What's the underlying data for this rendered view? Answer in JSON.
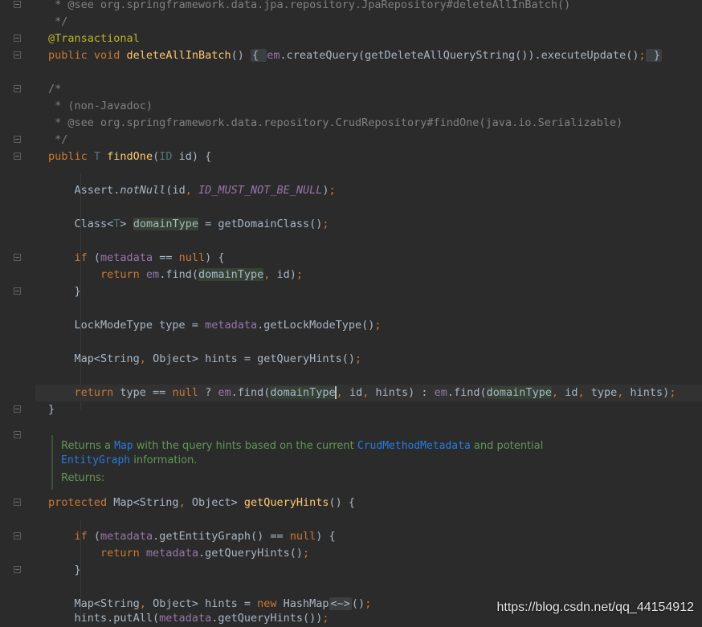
{
  "lines": [
    {
      "t": 6,
      "parts": [
        {
          "c": "cm",
          "s": " * @see org.springframework.data.jpa.repository.JpaRepository#deleteAllInBatch()"
        }
      ]
    },
    {
      "t": 27,
      "parts": [
        {
          "c": "cm",
          "s": " */"
        }
      ]
    },
    {
      "t": 48,
      "parts": [
        {
          "c": "an",
          "s": "@Transactional"
        }
      ]
    },
    {
      "t": 69,
      "parts": [
        {
          "c": "kw",
          "s": "public void "
        },
        {
          "c": "fn",
          "s": "deleteAllInBatch"
        },
        {
          "c": "",
          "s": "() "
        },
        {
          "c": "fold-inl",
          "s": "{ "
        },
        {
          "c": "fld",
          "s": "em"
        },
        {
          "c": "",
          "s": ".createQuery(getDeleteAllQueryString()).executeUpdate()"
        },
        {
          "c": "kw",
          "s": ";"
        },
        {
          "c": "fold-inl",
          "s": " }"
        }
      ]
    },
    {
      "t": 111,
      "parts": [
        {
          "c": "cm",
          "s": "/*"
        }
      ]
    },
    {
      "t": 132,
      "parts": [
        {
          "c": "cm",
          "s": " * (non-Javadoc)"
        }
      ]
    },
    {
      "t": 153,
      "parts": [
        {
          "c": "cm",
          "s": " * @see org.springframework.data.repository.CrudRepository#findOne(java.io.Serializable)"
        }
      ]
    },
    {
      "t": 174,
      "parts": [
        {
          "c": "cm",
          "s": " */"
        }
      ]
    },
    {
      "t": 195,
      "parts": [
        {
          "c": "kw",
          "s": "public "
        },
        {
          "c": "tp",
          "s": "T "
        },
        {
          "c": "fn",
          "s": "findOne"
        },
        {
          "c": "",
          "s": "("
        },
        {
          "c": "tp",
          "s": "ID"
        },
        {
          "c": "",
          "s": " id) {"
        }
      ]
    },
    {
      "t": 237,
      "parts": [
        {
          "c": "",
          "s": "    Assert."
        },
        {
          "c": "it",
          "s": "notNull"
        },
        {
          "c": "",
          "s": "(id"
        },
        {
          "c": "kw",
          "s": ", "
        },
        {
          "c": "cst",
          "s": "ID_MUST_NOT_BE_NULL"
        },
        {
          "c": "",
          "s": ")"
        },
        {
          "c": "kw",
          "s": ";"
        }
      ]
    },
    {
      "t": 279,
      "parts": [
        {
          "c": "",
          "s": "    Class<"
        },
        {
          "c": "tp",
          "s": "T"
        },
        {
          "c": "",
          "s": "> "
        },
        {
          "c": "hl",
          "s": "domainType"
        },
        {
          "c": "",
          "s": " = getDomainClass()"
        },
        {
          "c": "kw",
          "s": ";"
        }
      ]
    },
    {
      "t": 321,
      "parts": [
        {
          "c": "kw",
          "s": "    if "
        },
        {
          "c": "",
          "s": "("
        },
        {
          "c": "fld",
          "s": "metadata"
        },
        {
          "c": "",
          "s": " == "
        },
        {
          "c": "kw",
          "s": "null"
        },
        {
          "c": "",
          "s": ") {"
        }
      ]
    },
    {
      "t": 342,
      "parts": [
        {
          "c": "kw",
          "s": "        return "
        },
        {
          "c": "fld",
          "s": "em"
        },
        {
          "c": "",
          "s": ".find("
        },
        {
          "c": "hl",
          "s": "domainType"
        },
        {
          "c": "kw",
          "s": ", "
        },
        {
          "c": "",
          "s": "id)"
        },
        {
          "c": "kw",
          "s": ";"
        }
      ]
    },
    {
      "t": 363,
      "parts": [
        {
          "c": "",
          "s": "    }"
        }
      ]
    },
    {
      "t": 405,
      "parts": [
        {
          "c": "",
          "s": "    LockModeType type = "
        },
        {
          "c": "fld",
          "s": "metadata"
        },
        {
          "c": "",
          "s": ".getLockModeType()"
        },
        {
          "c": "kw",
          "s": ";"
        }
      ]
    },
    {
      "t": 447,
      "parts": [
        {
          "c": "",
          "s": "    Map<String"
        },
        {
          "c": "kw",
          "s": ", "
        },
        {
          "c": "",
          "s": "Object> hints = getQueryHints()"
        },
        {
          "c": "kw",
          "s": ";"
        }
      ]
    },
    {
      "t": 489,
      "cur": true,
      "parts": [
        {
          "c": "kw",
          "s": "    return "
        },
        {
          "c": "",
          "s": "type == "
        },
        {
          "c": "kw",
          "s": "null "
        },
        {
          "c": "",
          "s": "? "
        },
        {
          "c": "fld",
          "s": "em"
        },
        {
          "c": "",
          "s": ".find("
        },
        {
          "c": "hl",
          "s": "domainType"
        },
        {
          "c": "caret",
          "s": ""
        },
        {
          "c": "kw",
          "s": ", "
        },
        {
          "c": "",
          "s": "id"
        },
        {
          "c": "kw",
          "s": ", "
        },
        {
          "c": "",
          "s": "hints) : "
        },
        {
          "c": "fld",
          "s": "em"
        },
        {
          "c": "",
          "s": ".find("
        },
        {
          "c": "hl",
          "s": "domainType"
        },
        {
          "c": "kw",
          "s": ", "
        },
        {
          "c": "",
          "s": "id"
        },
        {
          "c": "kw",
          "s": ", "
        },
        {
          "c": "",
          "s": "type"
        },
        {
          "c": "kw",
          "s": ", "
        },
        {
          "c": "",
          "s": "hints)"
        },
        {
          "c": "kw",
          "s": ";"
        }
      ]
    },
    {
      "t": 510,
      "parts": [
        {
          "c": "",
          "s": "}"
        }
      ]
    },
    {
      "t": 626,
      "parts": [
        {
          "c": "kw",
          "s": "protected "
        },
        {
          "c": "",
          "s": "Map<String"
        },
        {
          "c": "kw",
          "s": ", "
        },
        {
          "c": "",
          "s": "Object> "
        },
        {
          "c": "fn",
          "s": "getQueryHints"
        },
        {
          "c": "",
          "s": "() {"
        }
      ]
    },
    {
      "t": 668,
      "parts": [
        {
          "c": "kw",
          "s": "    if "
        },
        {
          "c": "",
          "s": "("
        },
        {
          "c": "fld",
          "s": "metadata"
        },
        {
          "c": "",
          "s": ".getEntityGraph() == "
        },
        {
          "c": "kw",
          "s": "null"
        },
        {
          "c": "",
          "s": ") {"
        }
      ]
    },
    {
      "t": 689,
      "parts": [
        {
          "c": "kw",
          "s": "        return "
        },
        {
          "c": "fld",
          "s": "metadata"
        },
        {
          "c": "",
          "s": ".getQueryHints()"
        },
        {
          "c": "kw",
          "s": ";"
        }
      ]
    },
    {
      "t": 710,
      "parts": [
        {
          "c": "",
          "s": "    }"
        }
      ]
    },
    {
      "t": 752,
      "parts": [
        {
          "c": "",
          "s": "    Map<String"
        },
        {
          "c": "kw",
          "s": ", "
        },
        {
          "c": "",
          "s": "Object> hints = "
        },
        {
          "c": "kw",
          "s": "new "
        },
        {
          "c": "",
          "s": "HashMap"
        },
        {
          "c": "fold-inl",
          "s": "<~>"
        },
        {
          "c": "",
          "s": "()"
        },
        {
          "c": "kw",
          "s": ";"
        }
      ]
    },
    {
      "t": 770,
      "parts": [
        {
          "c": "",
          "s": "    hints.putAll("
        },
        {
          "c": "fld",
          "s": "metadata"
        },
        {
          "c": "",
          "s": ".getQueryHints())"
        },
        {
          "c": "kw",
          "s": ";"
        }
      ]
    }
  ],
  "folds": [
    6,
    48,
    69,
    111,
    174,
    195,
    321,
    363,
    510,
    542,
    626,
    668,
    710
  ],
  "doc": {
    "line1_a": "Returns a ",
    "line1_link1": "Map",
    "line1_b": " with the query hints based on the current ",
    "line1_link2": "CrudMethodMetadata",
    "line1_c": " and potential",
    "line2_link": "EntityGraph",
    "line2_b": " information.",
    "line3": "Returns:"
  },
  "watermark": "https://blog.csdn.net/qq_44154912",
  "colors": {
    "background": "#2b2b2b",
    "keyword": "#cc7832",
    "method": "#ffc66d",
    "field": "#9876aa",
    "comment": "#808080",
    "annotation": "#bbb529",
    "doc": "#629755"
  }
}
